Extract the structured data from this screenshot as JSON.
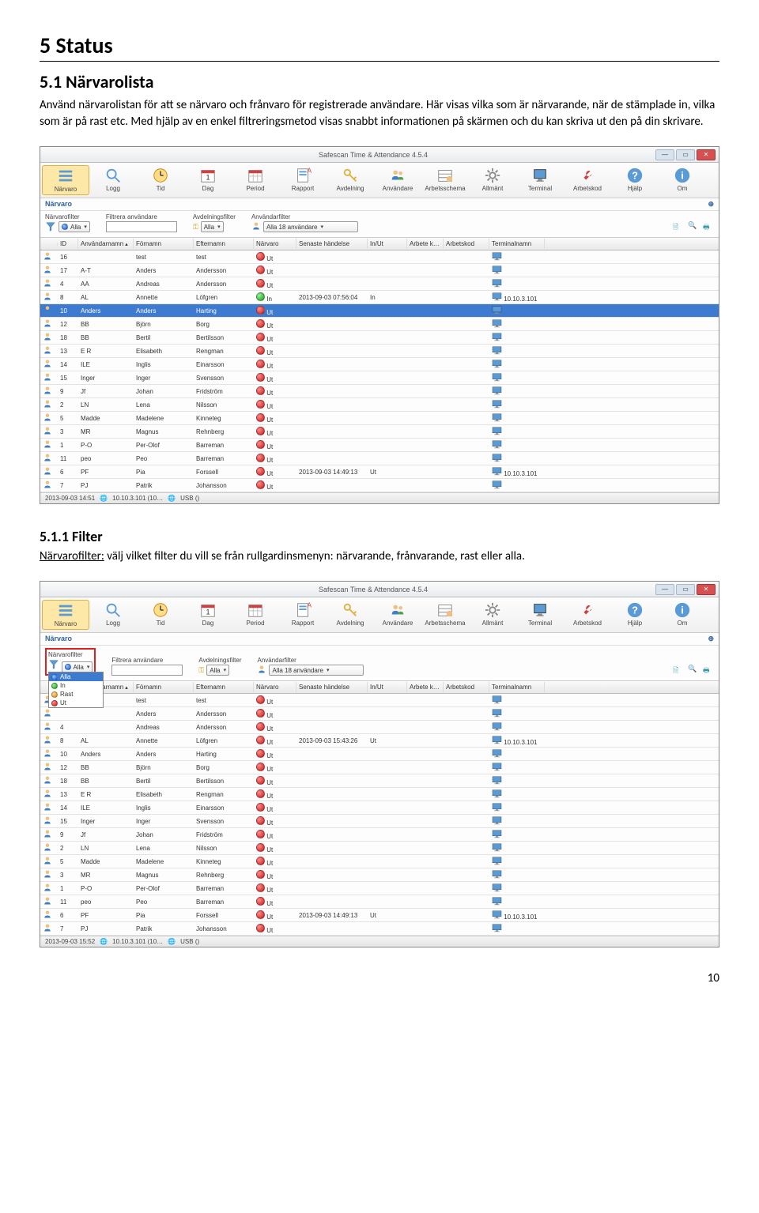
{
  "headings": {
    "h1": "5  Status",
    "h2": "5.1 Närvarolista",
    "h3": "5.1.1 Filter"
  },
  "paragraphs": {
    "intro": "Använd närvarolistan för att se närvaro och frånvaro för registrerade användare. Här visas vilka som är närvarande, när de stämplade in, vilka som är på rast etc. Med hjälp av en enkel filtreringsmetod visas snabbt informationen på skärmen och du kan skriva ut den på din skrivare.",
    "filter_lead": "Närvarofilter:",
    "filter_rest": " välj vilket filter du vill se från rullgardinsmenyn: närvarande, frånvarande, rast eller alla."
  },
  "page_number": "10",
  "app": {
    "title": "Safescan Time & Attendance 4.5.4",
    "section": "Närvaro",
    "toolbar": [
      {
        "label": "Närvaro",
        "icon": "list",
        "active": true
      },
      {
        "label": "Logg",
        "icon": "search"
      },
      {
        "label": "Tid",
        "icon": "clock"
      },
      {
        "label": "Dag",
        "icon": "cal1"
      },
      {
        "label": "Period",
        "icon": "cal"
      },
      {
        "label": "Rapport",
        "icon": "report"
      },
      {
        "label": "Avdelning",
        "icon": "key"
      },
      {
        "label": "Användare",
        "icon": "users"
      },
      {
        "label": "Arbetsschema",
        "icon": "schedule"
      },
      {
        "label": "Allmänt",
        "icon": "gear"
      },
      {
        "label": "Terminal",
        "icon": "monitor"
      },
      {
        "label": "Arbetskod",
        "icon": "wrench"
      },
      {
        "label": "Hjälp",
        "icon": "help"
      },
      {
        "label": "Om",
        "icon": "info"
      }
    ],
    "filters": {
      "presence_label": "Närvarofilter",
      "presence_value": "Alla",
      "user_label": "Filtrera användare",
      "user_value": "",
      "dept_label": "Avdelningsfilter",
      "dept_value": "Alla",
      "uf_label": "Användarfilter",
      "uf_value": "Alla 18 användare"
    },
    "columns": [
      "",
      "ID",
      "Användarnamn",
      "Förnamn",
      "Efternamn",
      "Närvaro",
      "Senaste händelse",
      "In/Ut",
      "Arbete k…",
      "Arbetskod",
      "Terminalnamn"
    ],
    "rows1": [
      {
        "id": "16",
        "u": "",
        "f": "test",
        "e": "test",
        "status": "red",
        "nv": "Ut"
      },
      {
        "id": "17",
        "u": "A-T",
        "f": "Anders",
        "e": "Andersson",
        "status": "red",
        "nv": "Ut"
      },
      {
        "id": "4",
        "u": "AA",
        "f": "Andreas",
        "e": "Andersson",
        "status": "red",
        "nv": "Ut"
      },
      {
        "id": "8",
        "u": "AL",
        "f": "Annette",
        "e": "Löfgren",
        "status": "green",
        "nv": "In",
        "ts": "2013-09-03 07:56:04",
        "io": "In",
        "term": "10.10.3.101"
      },
      {
        "id": "10",
        "u": "Anders",
        "f": "Anders",
        "e": "Harting",
        "status": "red",
        "nv": "Ut",
        "sel": true
      },
      {
        "id": "12",
        "u": "BB",
        "f": "Björn",
        "e": "Borg",
        "status": "red",
        "nv": "Ut"
      },
      {
        "id": "18",
        "u": "BB",
        "f": "Bertil",
        "e": "Bertilsson",
        "status": "red",
        "nv": "Ut"
      },
      {
        "id": "13",
        "u": "E R",
        "f": "Elisabeth",
        "e": "Rengman",
        "status": "red",
        "nv": "Ut"
      },
      {
        "id": "14",
        "u": "ILE",
        "f": "Inglis",
        "e": "Einarsson",
        "status": "red",
        "nv": "Ut"
      },
      {
        "id": "15",
        "u": "Inger",
        "f": "Inger",
        "e": "Svensson",
        "status": "red",
        "nv": "Ut"
      },
      {
        "id": "9",
        "u": "Jf",
        "f": "Johan",
        "e": "Fridström",
        "status": "red",
        "nv": "Ut"
      },
      {
        "id": "2",
        "u": "LN",
        "f": "Lena",
        "e": "Nilsson",
        "status": "red",
        "nv": "Ut"
      },
      {
        "id": "5",
        "u": "Madde",
        "f": "Madelene",
        "e": "Kinneteg",
        "status": "red",
        "nv": "Ut"
      },
      {
        "id": "3",
        "u": "MR",
        "f": "Magnus",
        "e": "Rehnberg",
        "status": "red",
        "nv": "Ut"
      },
      {
        "id": "1",
        "u": "P-O",
        "f": "Per-Olof",
        "e": "Barreman",
        "status": "red",
        "nv": "Ut"
      },
      {
        "id": "11",
        "u": "peo",
        "f": "Peo",
        "e": "Barreman",
        "status": "red",
        "nv": "Ut"
      },
      {
        "id": "6",
        "u": "PF",
        "f": "Pia",
        "e": "Forssell",
        "status": "red",
        "nv": "Ut",
        "ts": "2013-09-03 14:49:13",
        "io": "Ut",
        "term": "10.10.3.101"
      },
      {
        "id": "7",
        "u": "PJ",
        "f": "Patrik",
        "e": "Johansson",
        "status": "red",
        "nv": "Ut"
      }
    ],
    "rows2": [
      {
        "id": "",
        "u": "",
        "f": "test",
        "e": "test",
        "status": "red",
        "nv": "Ut"
      },
      {
        "id": "",
        "u": "",
        "f": "Anders",
        "e": "Andersson",
        "status": "red",
        "nv": "Ut"
      },
      {
        "id": "4",
        "u": "",
        "f": "Andreas",
        "e": "Andersson",
        "status": "red",
        "nv": "Ut"
      },
      {
        "id": "8",
        "u": "AL",
        "f": "Annette",
        "e": "Löfgren",
        "status": "red",
        "nv": "Ut",
        "ts": "2013-09-03 15:43:26",
        "io": "Ut",
        "term": "10.10.3.101"
      },
      {
        "id": "10",
        "u": "Anders",
        "f": "Anders",
        "e": "Harting",
        "status": "red",
        "nv": "Ut"
      },
      {
        "id": "12",
        "u": "BB",
        "f": "Björn",
        "e": "Borg",
        "status": "red",
        "nv": "Ut"
      },
      {
        "id": "18",
        "u": "BB",
        "f": "Bertil",
        "e": "Bertilsson",
        "status": "red",
        "nv": "Ut"
      },
      {
        "id": "13",
        "u": "E R",
        "f": "Elisabeth",
        "e": "Rengman",
        "status": "red",
        "nv": "Ut"
      },
      {
        "id": "14",
        "u": "ILE",
        "f": "Inglis",
        "e": "Einarsson",
        "status": "red",
        "nv": "Ut"
      },
      {
        "id": "15",
        "u": "Inger",
        "f": "Inger",
        "e": "Svensson",
        "status": "red",
        "nv": "Ut"
      },
      {
        "id": "9",
        "u": "Jf",
        "f": "Johan",
        "e": "Fridström",
        "status": "red",
        "nv": "Ut"
      },
      {
        "id": "2",
        "u": "LN",
        "f": "Lena",
        "e": "Nilsson",
        "status": "red",
        "nv": "Ut"
      },
      {
        "id": "5",
        "u": "Madde",
        "f": "Madelene",
        "e": "Kinneteg",
        "status": "red",
        "nv": "Ut"
      },
      {
        "id": "3",
        "u": "MR",
        "f": "Magnus",
        "e": "Rehnberg",
        "status": "red",
        "nv": "Ut"
      },
      {
        "id": "1",
        "u": "P-O",
        "f": "Per-Olof",
        "e": "Barreman",
        "status": "red",
        "nv": "Ut"
      },
      {
        "id": "11",
        "u": "peo",
        "f": "Peo",
        "e": "Barreman",
        "status": "red",
        "nv": "Ut"
      },
      {
        "id": "6",
        "u": "PF",
        "f": "Pia",
        "e": "Forssell",
        "status": "red",
        "nv": "Ut",
        "ts": "2013-09-03 14:49:13",
        "io": "Ut",
        "term": "10.10.3.101"
      },
      {
        "id": "7",
        "u": "PJ",
        "f": "Patrik",
        "e": "Johansson",
        "status": "red",
        "nv": "Ut"
      }
    ],
    "dropdown_options": [
      {
        "label": "Alla",
        "dot": "blue",
        "sel": true
      },
      {
        "label": "In",
        "dot": "green"
      },
      {
        "label": "Rast",
        "dot": "orange"
      },
      {
        "label": "Ut",
        "dot": "red"
      }
    ],
    "statusbar1": {
      "time": "2013-09-03 14:51",
      "ip": "10.10.3.101 (10…",
      "usb": "USB ()"
    },
    "statusbar2": {
      "time": "2013-09-03 15:52",
      "ip": "10.10.3.101 (10…",
      "usb": "USB ()"
    }
  }
}
